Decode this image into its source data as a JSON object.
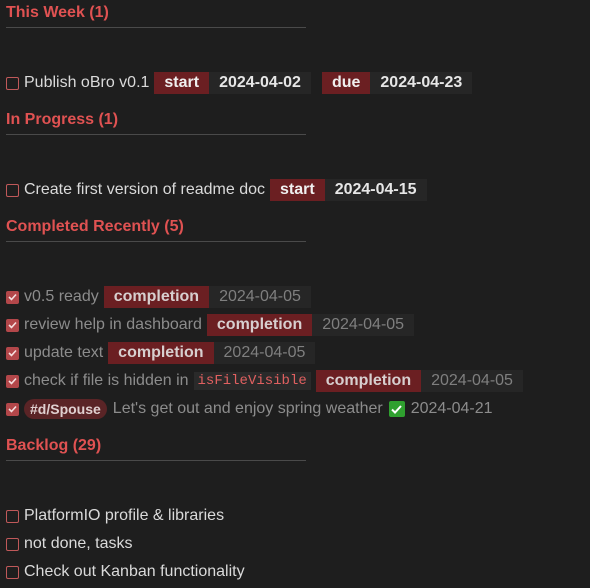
{
  "sections": {
    "this_week": {
      "title": "This Week (1)"
    },
    "in_progress": {
      "title": "In Progress (1)"
    },
    "completed": {
      "title": "Completed Recently (5)"
    },
    "backlog": {
      "title": "Backlog (29)"
    }
  },
  "this_week": {
    "task": "Publish oBro v0.1",
    "start_label": "start",
    "start_value": "2024-04-02",
    "due_label": "due",
    "due_value": "2024-04-23"
  },
  "in_progress": {
    "task": "Create first version of readme doc",
    "start_label": "start",
    "start_value": "2024-04-15"
  },
  "completed": {
    "items": [
      {
        "text": "v0.5 ready",
        "label": "completion",
        "value": "2024-04-05"
      },
      {
        "text": "review help in dashboard",
        "label": "completion",
        "value": "2024-04-05"
      },
      {
        "text": "update text",
        "label": "completion",
        "value": "2024-04-05"
      },
      {
        "text": "check if file is hidden in",
        "code": "isFileVisible",
        "label": "completion",
        "value": "2024-04-05"
      },
      {
        "tag": "#d/Spouse",
        "text": "Let's get out and enjoy spring weather",
        "check_icon": "green-check-icon",
        "value": "2024-04-21"
      }
    ]
  },
  "backlog": {
    "items": [
      {
        "text": "PlatformIO profile & libraries"
      },
      {
        "text": "not done, tasks"
      },
      {
        "text": "Check out Kanban functionality"
      }
    ]
  },
  "colors": {
    "heading": "#e05252",
    "label_bg": "#6b1f22",
    "value_bg": "#262626",
    "checkbox": "#b3474a"
  }
}
